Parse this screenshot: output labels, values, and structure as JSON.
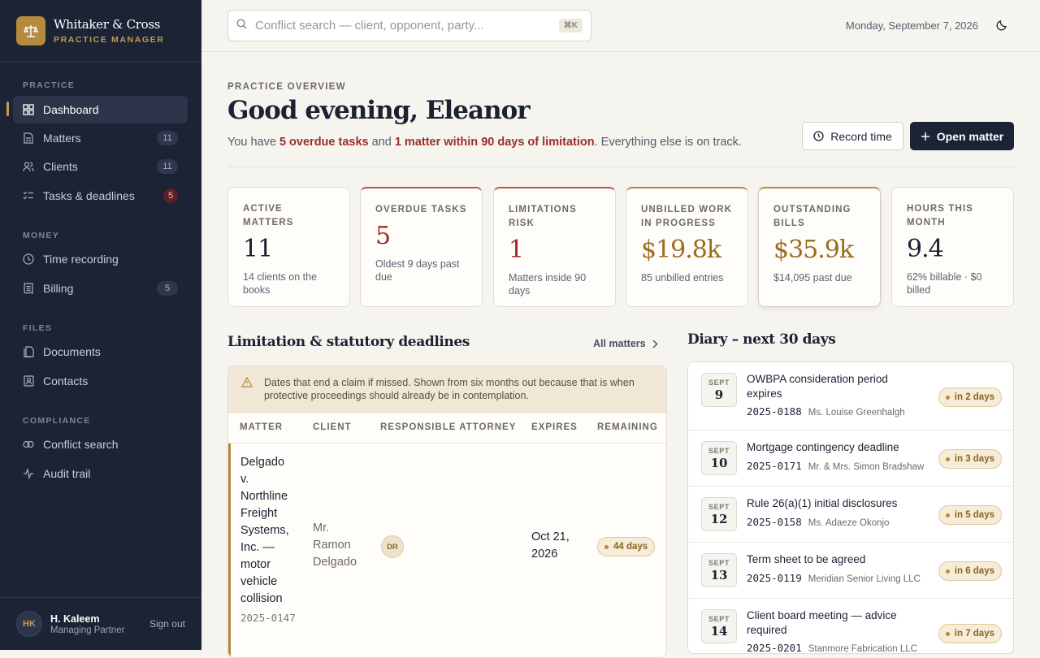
{
  "brand": {
    "name": "Whitaker & Cross",
    "sub": "PRACTICE MANAGER"
  },
  "nav": {
    "sections": {
      "practice": "PRACTICE",
      "money": "MONEY",
      "files": "FILES",
      "compliance": "COMPLIANCE"
    },
    "items": [
      {
        "label": "Dashboard",
        "icon": "grid-icon"
      },
      {
        "label": "Matters",
        "count": "11",
        "icon": "file-icon"
      },
      {
        "label": "Clients",
        "count": "11",
        "icon": "users-icon"
      },
      {
        "label": "Tasks & deadlines",
        "count": "5",
        "icon": "checklist-icon"
      },
      {
        "label": "Time recording",
        "icon": "clock-icon"
      },
      {
        "label": "Billing",
        "count": "5",
        "icon": "receipt-icon"
      },
      {
        "label": "Documents",
        "icon": "documents-icon"
      },
      {
        "label": "Contacts",
        "icon": "contact-icon"
      },
      {
        "label": "Conflict search",
        "icon": "link-icon"
      },
      {
        "label": "Audit trail",
        "icon": "activity-icon"
      }
    ]
  },
  "user": {
    "initials": "HK",
    "name": "H. Kaleem",
    "role": "Managing Partner",
    "signout": "Sign out"
  },
  "topbar": {
    "search_placeholder": "Conflict search — client, opponent, party...",
    "shortcut": "⌘K",
    "date": "Monday, September 7, 2026"
  },
  "header": {
    "eyebrow": "PRACTICE OVERVIEW",
    "greeting": "Good evening, Eleanor",
    "summary_pre": "You have ",
    "summary_b1": "5 overdue tasks",
    "summary_mid": " and ",
    "summary_b2": "1 matter within 90 days of limitation",
    "summary_post": ". Everything else is on track.",
    "record_time": "Record time",
    "open_matter": "Open matter"
  },
  "stats": [
    {
      "label": "Active matters",
      "value": "11",
      "sub": "14 clients on the books"
    },
    {
      "label": "Overdue tasks",
      "value": "5",
      "sub": "Oldest 9 days past due"
    },
    {
      "label": "Limitations risk",
      "value": "1",
      "sub": "Matters inside 90 days"
    },
    {
      "label": "Unbilled work in progress",
      "value": "$19.8k",
      "sub": "85 unbilled entries"
    },
    {
      "label": "Outstanding bills",
      "value": "$35.9k",
      "sub": "$14,095 past due"
    },
    {
      "label": "Hours this month",
      "value": "9.4",
      "sub": "62% billable · $0 billed"
    }
  ],
  "limitations": {
    "title": "Limitation & statutory deadlines",
    "all_link": "All matters",
    "warning": "Dates that end a claim if missed. Shown from six months out because that is when protective proceedings should already be in contemplation.",
    "columns": [
      "MATTER",
      "CLIENT",
      "RESPONSIBLE ATTORNEY",
      "EXPIRES",
      "REMAINING"
    ],
    "rows": [
      {
        "matter": "Delgado v. Northline Freight Systems, Inc. — motor vehicle collision",
        "code": "2025-0147",
        "client": "Mr. Ramon Delgado",
        "attorney": "DR",
        "expires": "Oct 21, 2026",
        "remaining": "44 days"
      }
    ]
  },
  "diary": {
    "title": "Diary – next 30 days",
    "items": [
      {
        "mon": "SEPT",
        "day": "9",
        "title": "OWBPA consideration period expires",
        "code": "2025-0188",
        "client": "Ms. Louise Greenhalgh",
        "due": "in 2 days"
      },
      {
        "mon": "SEPT",
        "day": "10",
        "title": "Mortgage contingency deadline",
        "code": "2025-0171",
        "client": "Mr. & Mrs. Simon Bradshaw",
        "due": "in 3 days"
      },
      {
        "mon": "SEPT",
        "day": "12",
        "title": "Rule 26(a)(1) initial disclosures",
        "code": "2025-0158",
        "client": "Ms. Adaeze Okonjo",
        "due": "in 5 days"
      },
      {
        "mon": "SEPT",
        "day": "13",
        "title": "Term sheet to be agreed",
        "code": "2025-0119",
        "client": "Meridian Senior Living LLC",
        "due": "in 6 days"
      },
      {
        "mon": "SEPT",
        "day": "14",
        "title": "Client board meeting — advice required",
        "code": "2025-0201",
        "client": "Stanmore Fabrication LLC",
        "due": "in 7 days"
      }
    ]
  },
  "colors": {
    "accent": "#b58a3c",
    "sidebar": "#1b2335",
    "danger": "#9b2e2a"
  }
}
